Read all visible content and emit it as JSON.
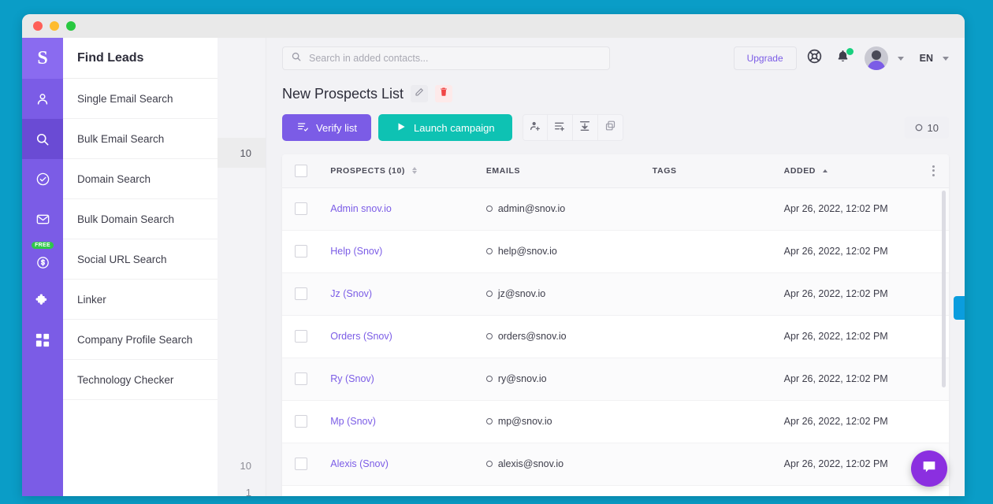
{
  "window": {
    "dots": [
      "close",
      "minimize",
      "maximize"
    ]
  },
  "rail": {
    "logo": "S",
    "items": [
      {
        "name": "person-icon",
        "badge": ""
      },
      {
        "name": "search-icon",
        "badge": ""
      },
      {
        "name": "check-circle-icon",
        "badge": ""
      },
      {
        "name": "envelope-icon",
        "badge": ""
      },
      {
        "name": "dollar-circle-icon",
        "badge": "FREE"
      },
      {
        "name": "puzzle-icon",
        "badge": ""
      },
      {
        "name": "grid-icon",
        "badge": ""
      }
    ]
  },
  "subnav": {
    "title": "Find Leads",
    "items": [
      "Single Email Search",
      "Bulk Email Search",
      "Domain Search",
      "Bulk Domain Search",
      "Social URL Search",
      "Linker",
      "Company Profile Search",
      "Technology Checker"
    ]
  },
  "gutter": {
    "top_count": "10",
    "bottom_count": "10",
    "bottom_page": "1"
  },
  "topbar": {
    "search_placeholder": "Search in added contacts...",
    "search_value": "",
    "upgrade_label": "Upgrade",
    "language": "EN"
  },
  "page": {
    "title": "New Prospects List",
    "verify_label": "Verify list",
    "launch_label": "Launch campaign",
    "count_label": "10",
    "icon_buttons": [
      "add-prospect-icon",
      "add-to-list-icon",
      "download-icon",
      "duplicate-icon"
    ]
  },
  "table": {
    "columns": [
      "PROSPECTS (10)",
      "EMAILS",
      "TAGS",
      "ADDED"
    ],
    "rows": [
      {
        "name": "Admin snov.io",
        "email": "admin@snov.io",
        "tags": "",
        "added": "Apr 26, 2022, 12:02 PM"
      },
      {
        "name": "Help (Snov)",
        "email": "help@snov.io",
        "tags": "",
        "added": "Apr 26, 2022, 12:02 PM"
      },
      {
        "name": "Jz (Snov)",
        "email": "jz@snov.io",
        "tags": "",
        "added": "Apr 26, 2022, 12:02 PM"
      },
      {
        "name": "Orders (Snov)",
        "email": "orders@snov.io",
        "tags": "",
        "added": "Apr 26, 2022, 12:02 PM"
      },
      {
        "name": "Ry (Snov)",
        "email": "ry@snov.io",
        "tags": "",
        "added": "Apr 26, 2022, 12:02 PM"
      },
      {
        "name": "Mp (Snov)",
        "email": "mp@snov.io",
        "tags": "",
        "added": "Apr 26, 2022, 12:02 PM"
      },
      {
        "name": "Alexis (Snov)",
        "email": "alexis@snov.io",
        "tags": "",
        "added": "Apr 26, 2022, 12:02 PM"
      }
    ]
  },
  "colors": {
    "brand_purple": "#7b5ce6",
    "teal": "#0ec2b3",
    "page_backdrop": "#0a9dc7",
    "chat_purple": "#8b2fe0",
    "badge_green": "#2fc74a"
  }
}
